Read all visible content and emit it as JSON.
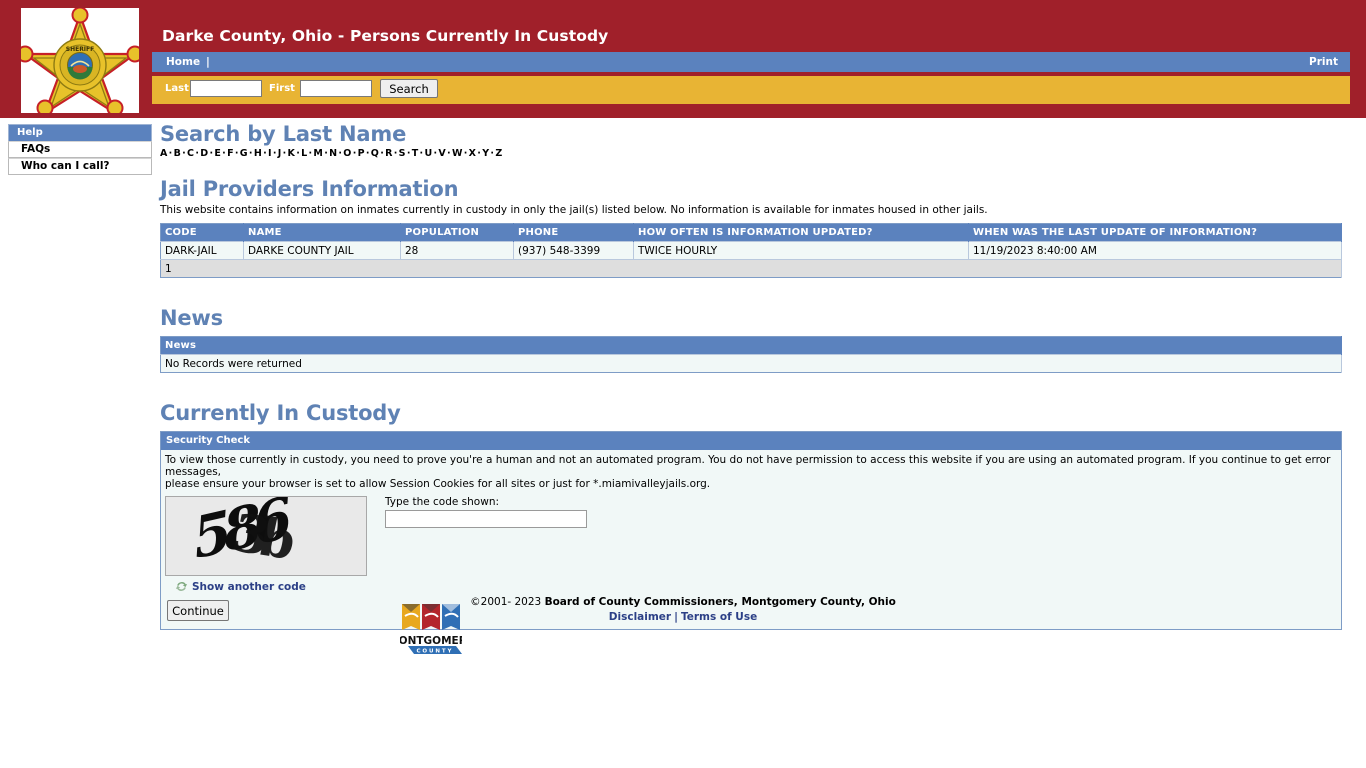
{
  "header": {
    "title": "Darke County, Ohio - Persons Currently In Custody",
    "badge_alt": "darke-county-sheriff-badge",
    "colors": {
      "banner_red": "#a0202a",
      "nav_blue": "#5b82be",
      "search_gold": "#e8b434",
      "link_blue": "#2b3f86",
      "heading_blue": "#5f82b4"
    },
    "nav": {
      "home_label": "Home",
      "separator": "|",
      "print_label": "Print"
    },
    "search": {
      "last_label": "Last",
      "last_value": "",
      "last_placeholder": "",
      "first_label": "First",
      "first_value": "",
      "first_placeholder": "",
      "search_button": "Search"
    }
  },
  "sidebar": {
    "header_label": "Help",
    "items": [
      {
        "label": "FAQs"
      },
      {
        "label": "Who can I call?"
      }
    ]
  },
  "main": {
    "search_by_last_name": {
      "title": "Search by Last Name",
      "letters": [
        "A",
        "B",
        "C",
        "D",
        "E",
        "F",
        "G",
        "H",
        "I",
        "J",
        "K",
        "L",
        "M",
        "N",
        "O",
        "P",
        "Q",
        "R",
        "S",
        "T",
        "U",
        "V",
        "W",
        "X",
        "Y",
        "Z"
      ],
      "separator": "·"
    },
    "jail_providers": {
      "title": "Jail Providers Information",
      "intro": "This website contains information on inmates currently in custody in only the jail(s) listed below. No information is available for inmates housed in other jails.",
      "columns": [
        "CODE",
        "NAME",
        "POPULATION",
        "PHONE",
        "HOW OFTEN IS INFORMATION UPDATED?",
        "WHEN WAS THE LAST UPDATE OF INFORMATION?"
      ],
      "rows": [
        {
          "code": "DARK-JAIL",
          "name": "DARKE COUNTY JAIL",
          "population": "28",
          "phone": "(937) 548-3399",
          "update_frequency": "TWICE HOURLY",
          "last_update": "11/19/2023 8:40:00 AM"
        }
      ],
      "page_number": "1"
    },
    "news": {
      "title": "News",
      "column": "News",
      "empty_message": "No Records were returned"
    },
    "currently_in_custody": {
      "title": "Currently In Custody",
      "security_check": {
        "header": "Security Check",
        "paragraph_line1": "To view those currently in custody, you need to prove you're a human and not an automated program. You do not have permission to access this website if you are using an automated program. If you continue to get error messages,",
        "paragraph_line2": "please ensure your browser is set to allow Session Cookies for all sites or just for *.miamivalleyjails.org.",
        "captcha_code": "5863b",
        "refresh_label": "Show another code",
        "input_label": "Type the code shown:",
        "input_value": "",
        "input_placeholder": "",
        "continue_button": "Continue"
      }
    }
  },
  "footer": {
    "copyright_prefix": "©2001- 2023 ",
    "copyright_owner": "Board of County Commissioners, Montgomery County, Ohio",
    "disclaimer_label": "Disclaimer",
    "pipe": "|",
    "terms_label": "Terms of Use",
    "logo_text_top": "MONTGOMERY",
    "logo_text_bottom": "C O U N T Y"
  }
}
